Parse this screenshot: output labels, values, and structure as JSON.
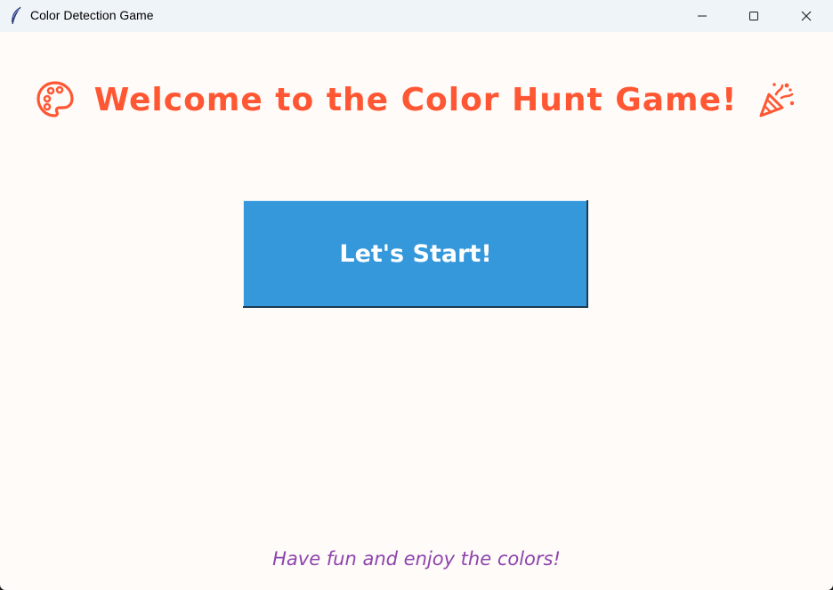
{
  "window": {
    "title": "Color Detection Game",
    "icon": "feather-icon",
    "controls": [
      "minimize-icon",
      "maximize-icon",
      "close-icon"
    ]
  },
  "main": {
    "headline": "Welcome to the Color Hunt Game!",
    "headline_icons": [
      "palette-icon",
      "party-popper-icon"
    ],
    "start_button_label": "Let's Start!",
    "footer": "Have fun and enjoy the colors!"
  },
  "colors": {
    "background": "#fffbf8",
    "headline": "#ff5733",
    "button": "#3498db",
    "button_text": "#ffffff",
    "footer": "#8e44ad"
  }
}
